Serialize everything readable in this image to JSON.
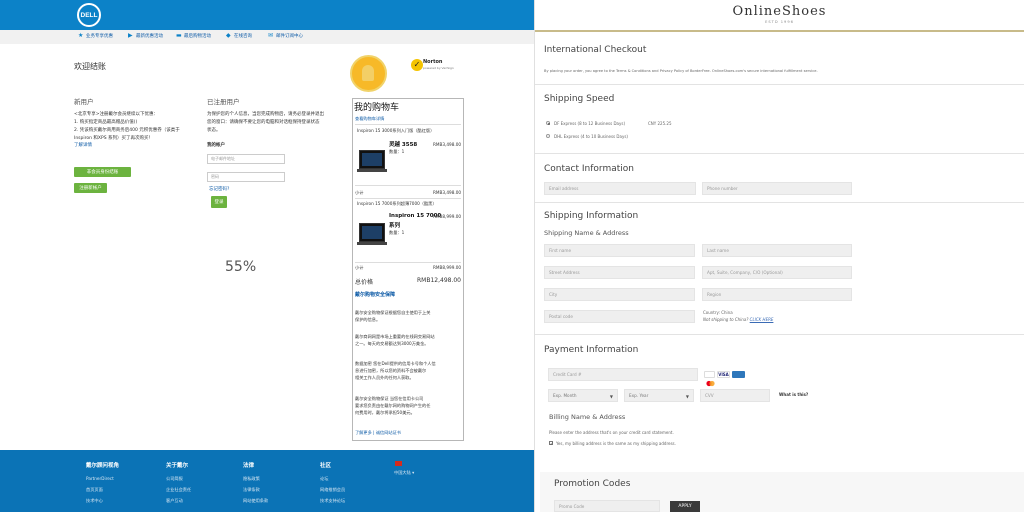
{
  "dell": {
    "logo": "DELL",
    "nav": [
      {
        "label": "业务专享优惠",
        "icon": "star-icon"
      },
      {
        "label": "最新优惠活动",
        "icon": "megaphone-icon"
      },
      {
        "label": "最后购物活动",
        "icon": "cart-icon"
      },
      {
        "label": "在线咨询",
        "icon": "chat-icon"
      },
      {
        "label": "邮件订阅中心",
        "icon": "mail-icon"
      }
    ],
    "page_title": "欢迎结账",
    "new_user": {
      "title": "新用户",
      "lines": [
        "<北京专享>注册戴尔会员继续以下优惠：",
        "1. 购买指定商品最高赠品价值()",
        "2. 凭该购买戴尔商用商务后400 元积优惠券（该类于",
        "Inspiron 和XPS 系列）买了再次购买！"
      ],
      "details_link": "了解详情",
      "btn_guest": "非会员身份结账",
      "btn_register": "注册新帐户"
    },
    "existing": {
      "title": "已注册用户",
      "lines": [
        "为保护您的个人信息，当您完成购物后，请务必登录并退出",
        "您的窗口：请确保不要让您的电脑和对话框保持登录状态",
        "状态。"
      ],
      "account_label": "我的帐户",
      "email_placeholder": "电子邮件地址",
      "password_placeholder": "密码",
      "forgot": "忘记密码?",
      "login_btn": "登录"
    },
    "progress_text": "55%",
    "norton": {
      "brand": "Norton",
      "sub": "powered by VeriSign"
    },
    "cart": {
      "title": "我的购物车",
      "edit_link": "查看购物车详情",
      "item1_header": "Inspiron 15 3000系列入门版（酷红版）",
      "item1_name": "灵越 3558",
      "item1_qty": "数量：1",
      "item1_price": "RMB3,498.00",
      "sub1_label": "小计",
      "sub1_price": "RMB3,498.00",
      "item2_header": "Inspiron 15 7000系列超薄7000（酷黑）",
      "item2_name": "Inspiron 15 7000",
      "item2_name2": "系列",
      "item2_qty": "数量：1",
      "item2_price": "RMB8,999.00",
      "sub2_label": "小计",
      "sub2_price": "RMB8,999.00",
      "total_label": "总价格",
      "total_price": "RMB12,498.00",
      "guarantee_title": "戴尔购物安全保障",
      "g_lines": [
        "戴尔安全购物保证根据您自主使用于上关",
        "保护的信息。",
        "戴尔商网网是市场上重要的在线网交易网站",
        "之一。每天的交易额达到3000万美金。",
        "数据加密 您在Dell提供的信用卡号和个人信",
        "息进行加密，所以您的资料不会被戴尔",
        "相关工作人员外的任何人获取。",
        "戴尔安全购物保证 当您在信用卡公司",
        "要求您负责由在戴尔网的购物网产生的任",
        "何费用时，戴尔将承担50美元。"
      ],
      "learn_more": "了解更多 | 诚信网站证书"
    },
    "footer": {
      "cols": [
        {
          "title": "戴尔顾问视角",
          "items": [
            "PartnerDirect",
            "首页页面",
            "技术中心"
          ]
        },
        {
          "title": "关于戴尔",
          "items": [
            "公司简报",
            "企业社会责任",
            "客户互动"
          ]
        },
        {
          "title": "法律",
          "items": [
            "隐私政策",
            "法律条款",
            "网站使用条款"
          ]
        },
        {
          "title": "社区",
          "items": [
            "论坛",
            "网络推销会员",
            "技术支持论坛"
          ]
        }
      ],
      "region": "中国大陆"
    }
  },
  "onlineshoes": {
    "logo": "OnlineShoes",
    "est": "ESTD 1996",
    "checkout_title": "International Checkout",
    "terms_text": "By placing your order, you agree to the Terms & Conditions and Privacy Policy of BorderFree. OnlineShoes.com's secure international fulfillment service.",
    "shipping_speed_title": "Shipping Speed",
    "ship_options": [
      {
        "label": "DF Express (8 to 12 Business Days)",
        "price": "CNY 225.25",
        "selected": true
      },
      {
        "label": "DHL Express (4 to 10 Business Days)",
        "price": "",
        "selected": false
      }
    ],
    "contact_title": "Contact Information",
    "email_placeholder": "Email address",
    "phone_placeholder": "Phone number",
    "shipping_info_title": "Shipping Information",
    "shipping_name_title": "Shipping Name & Address",
    "first_name": "First name",
    "last_name": "Last name",
    "street": "Street Address",
    "apt": "Apt, Suite, Company, C/O (Optional)",
    "city": "City",
    "region": "Region",
    "postal": "Postal code",
    "country_label": "Country: China",
    "not_shipping": "Not shipping to China?",
    "click_here": "CLICK HERE",
    "payment_title": "Payment Information",
    "credit_card": "Credit Card #",
    "exp_month": "Exp. Month",
    "exp_year": "Exp. Year",
    "cvv": "CVV",
    "what_is_this": "What is this?",
    "billing_title": "Billing Name & Address",
    "billing_note": "Please enter the address that's on your credit card statement.",
    "same_address": "Yes, my billing address is the same as my shipping address.",
    "promo_title": "Promotion Codes",
    "promo_placeholder": "Promo Code",
    "apply": "APPLY"
  }
}
